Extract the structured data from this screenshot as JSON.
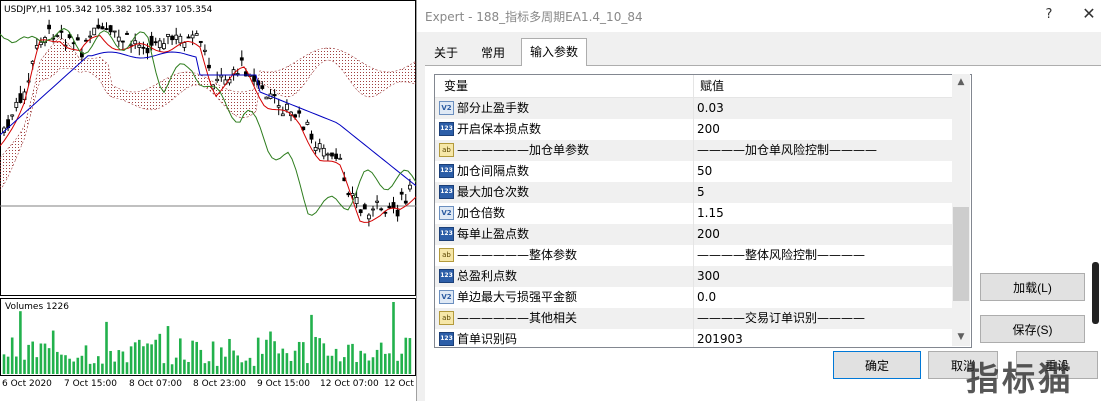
{
  "chart": {
    "symbol_info": "USDJPY,H1  105.342 105.382 105.337 105.354",
    "volumes_label": "Volumes 1226",
    "x_ticks": [
      "6 Oct 2020",
      "7 Oct 15:00",
      "8 Oct 07:00",
      "8 Oct 23:00",
      "9 Oct 15:00",
      "12 Oct 07:00",
      "12 Oct"
    ],
    "colors": {
      "tenkan": "#d40000",
      "kijun": "#0000c0",
      "chikou": "#2e7d1e",
      "cloud": "#a04040",
      "volume": "#22b14c"
    }
  },
  "dialog": {
    "title": "Expert - 188_指标多周期EA1.4_10_84",
    "help_icon": "?",
    "close_icon": "✕",
    "tabs": [
      "关于",
      "常用",
      "输入参数"
    ],
    "active_tab": "输入参数",
    "grid": {
      "col_variable": "变量",
      "col_value": "赋值",
      "rows": [
        {
          "icon": "double",
          "name": "部分止盈手数",
          "value": "0.03"
        },
        {
          "icon": "int",
          "name": "开启保本损点数",
          "value": "200"
        },
        {
          "icon": "string",
          "name": "——————加仓单参数",
          "value": "————加仓单风险控制————"
        },
        {
          "icon": "int",
          "name": "加仓间隔点数",
          "value": "50"
        },
        {
          "icon": "int",
          "name": "最大加仓次数",
          "value": "5"
        },
        {
          "icon": "double",
          "name": "加仓倍数",
          "value": "1.15"
        },
        {
          "icon": "int",
          "name": "每单止盈点数",
          "value": "200"
        },
        {
          "icon": "string",
          "name": "——————整体参数",
          "value": "————整体风险控制————"
        },
        {
          "icon": "int",
          "name": "总盈利点数",
          "value": "300"
        },
        {
          "icon": "double",
          "name": "单边最大亏损强平金额",
          "value": "0.0"
        },
        {
          "icon": "string",
          "name": "——————其他相关",
          "value": "————交易订单识别————"
        },
        {
          "icon": "int",
          "name": "首单识别码",
          "value": "201903"
        }
      ]
    },
    "buttons": {
      "load": "加载(L)",
      "save": "保存(S)",
      "ok": "确定",
      "cancel": "取消",
      "reset": "重设"
    },
    "icon_glyphs": {
      "int": "123",
      "double": "V2",
      "string": "ab"
    }
  },
  "watermark": "指标猫"
}
